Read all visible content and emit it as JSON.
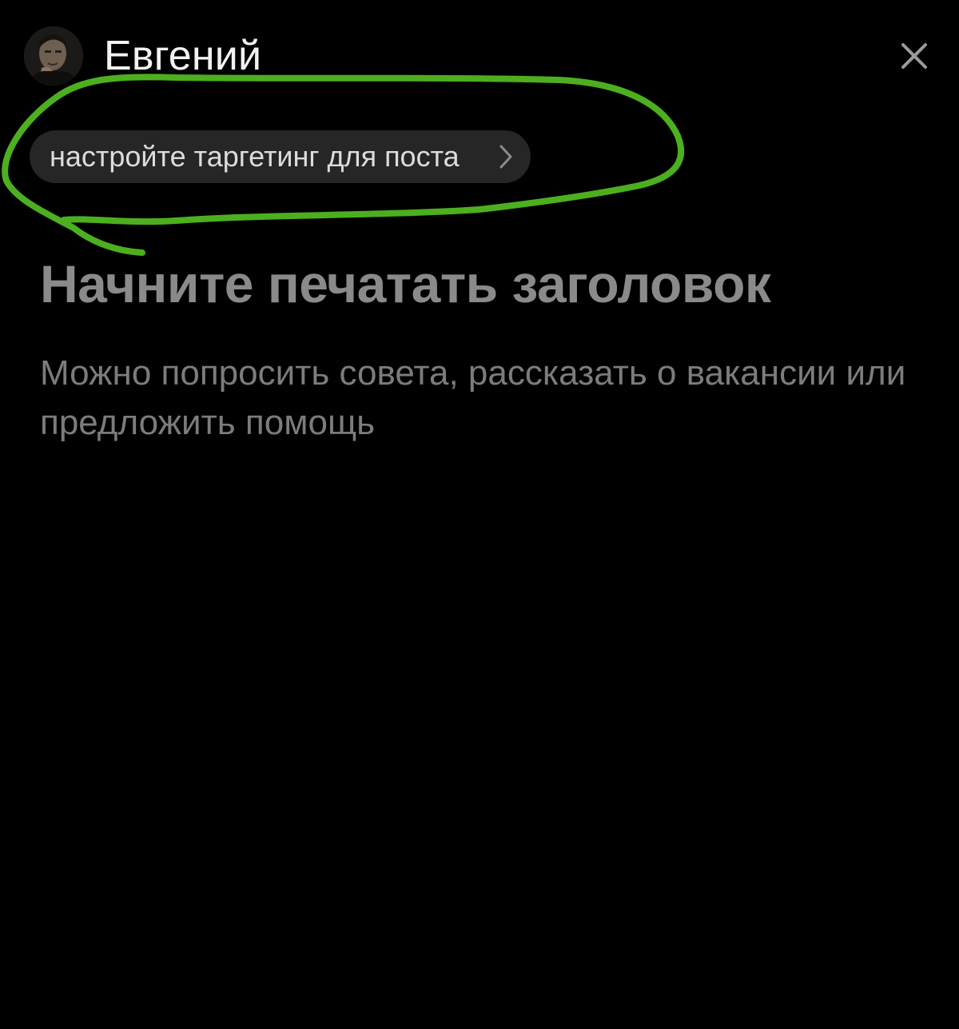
{
  "header": {
    "author_name": "Евгений",
    "avatar_icon": "user-photo-avatar",
    "close_icon": "close-icon"
  },
  "targeting": {
    "label": "настройте таргетинг для поста",
    "icon": "chevron-right-icon"
  },
  "editor": {
    "title_placeholder": "Начните печатать заголовок",
    "body_placeholder": "Можно попросить совета, рассказать о вакансии или предложить помощь"
  },
  "colors": {
    "background": "#000000",
    "chip_background": "#262626",
    "annotation_stroke": "#4caf1f",
    "placeholder_text": "#8a8a8a"
  }
}
